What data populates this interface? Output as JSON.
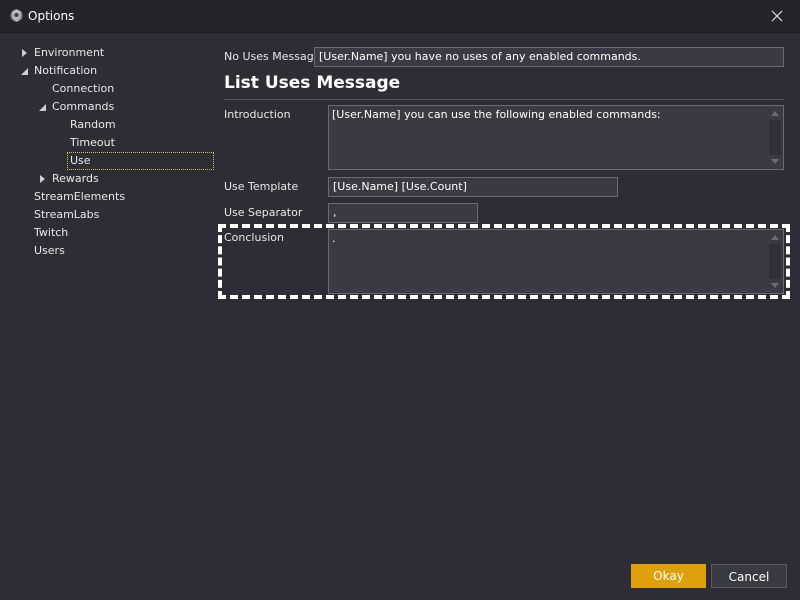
{
  "window": {
    "title": "Options",
    "app_icon": "app-logo-icon",
    "close_icon": "close-icon"
  },
  "tree": {
    "items": [
      {
        "label": "Environment",
        "expanded": false,
        "has_children": true
      },
      {
        "label": "Notification",
        "expanded": true,
        "has_children": true
      },
      {
        "label": "Connection"
      },
      {
        "label": "Commands",
        "expanded": true,
        "has_children": true
      },
      {
        "label": "Random"
      },
      {
        "label": "Timeout"
      },
      {
        "label": "Use",
        "selected": true
      },
      {
        "label": "Rewards",
        "expanded": false,
        "has_children": true
      },
      {
        "label": "StreamElements"
      },
      {
        "label": "StreamLabs"
      },
      {
        "label": "Twitch"
      },
      {
        "label": "Users"
      }
    ]
  },
  "form": {
    "no_uses_label": "No Uses Message",
    "no_uses_value": "[User.Name] you have no uses of any enabled commands.",
    "section_title": "List Uses Message",
    "introduction_label": "Introduction",
    "introduction_value": "[User.Name] you can use the following enabled commands:",
    "use_template_label": "Use Template",
    "use_template_value": "[Use.Name] [Use.Count]",
    "use_separator_label": "Use Separator",
    "use_separator_value": ",",
    "conclusion_label": "Conclusion",
    "conclusion_value": "."
  },
  "buttons": {
    "okay": "Okay",
    "cancel": "Cancel"
  },
  "colors": {
    "background": "#2d2e35",
    "accent": "#e0a00c",
    "selection_border": "#d8c24a"
  }
}
